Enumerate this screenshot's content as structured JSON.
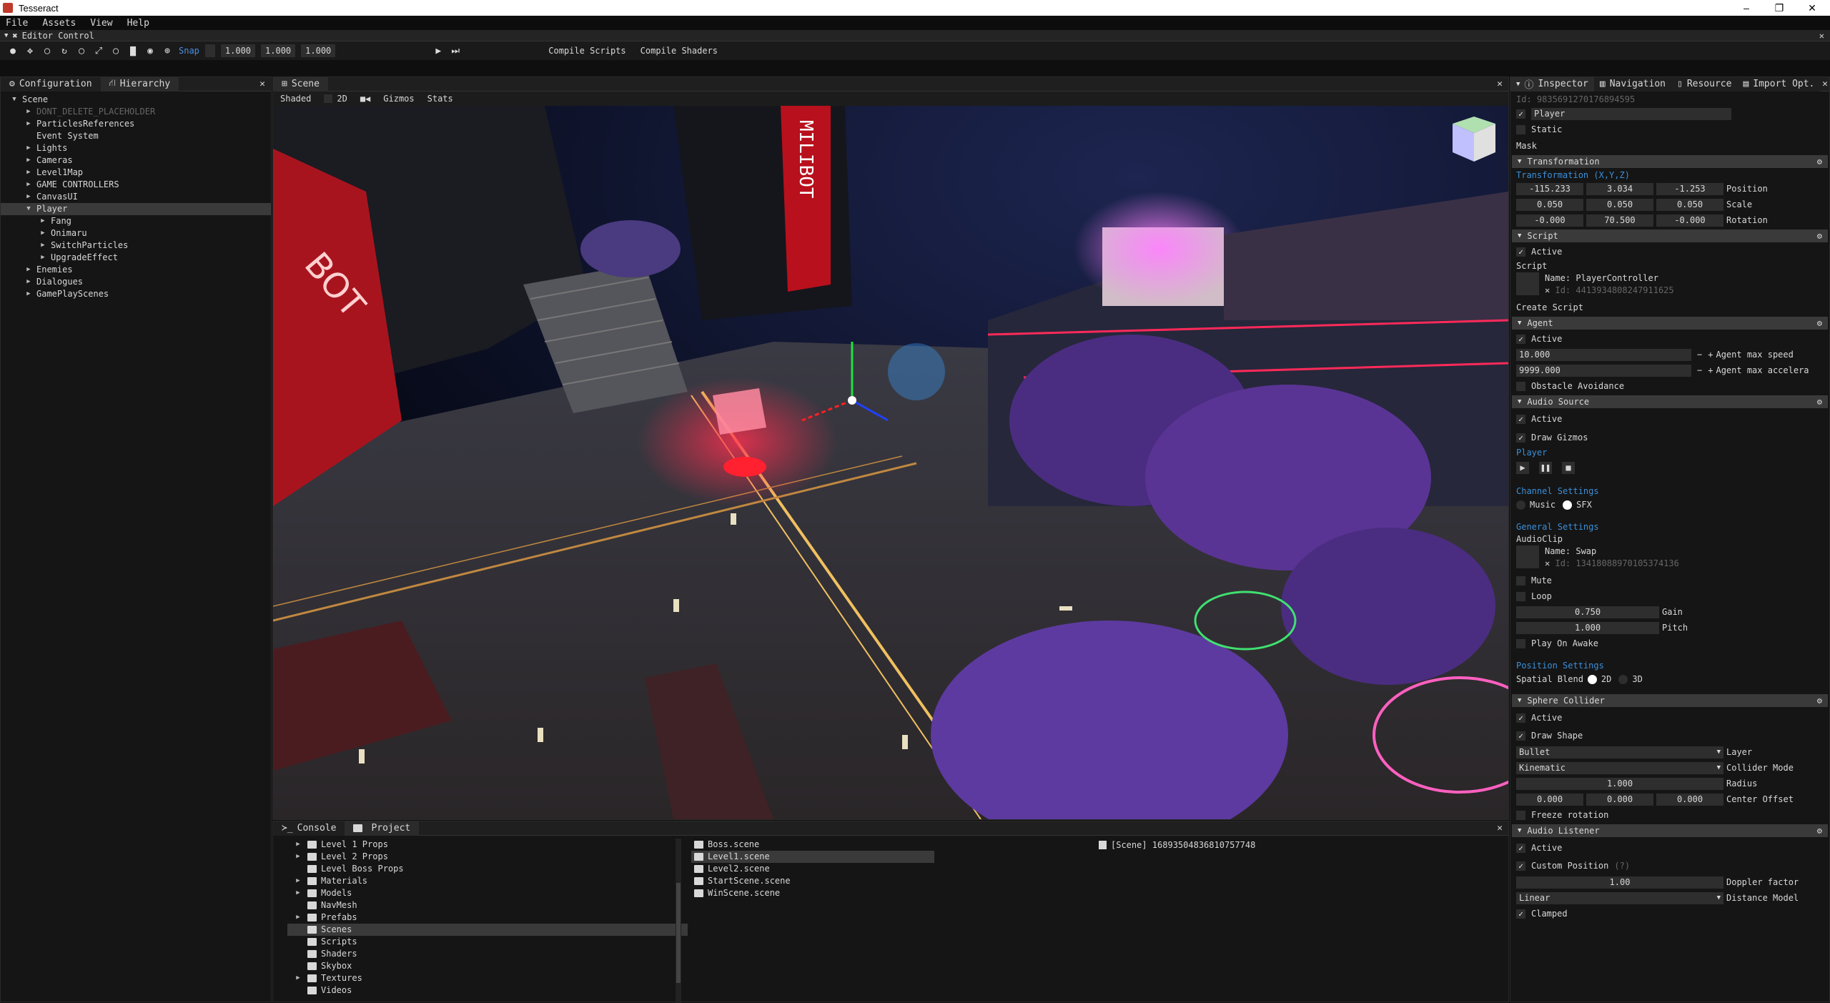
{
  "window": {
    "title": "Tesseract",
    "minimize": "–",
    "maximize": "❐",
    "close": "✕"
  },
  "menu": [
    "File",
    "Assets",
    "View",
    "Help"
  ],
  "editor_control": {
    "title": "Editor Control",
    "close": "✕"
  },
  "toolbar": {
    "snap_label": "Snap",
    "snap_values": [
      "1.000",
      "1.000",
      "1.000"
    ],
    "compile_scripts": "Compile Scripts",
    "compile_shaders": "Compile Shaders"
  },
  "left_panel": {
    "tabs": [
      "Configuration",
      "Hierarchy"
    ],
    "close": "✕",
    "tree": [
      {
        "label": "Scene",
        "depth": 0,
        "arrow": "▼",
        "dim": false,
        "selected": false
      },
      {
        "label": "DONT_DELETE_PLACEHOLDER",
        "depth": 1,
        "arrow": "▶",
        "dim": true,
        "selected": false
      },
      {
        "label": "ParticlesReferences",
        "depth": 1,
        "arrow": "▶",
        "dim": false,
        "selected": false
      },
      {
        "label": "Event System",
        "depth": 1,
        "arrow": "",
        "dim": false,
        "selected": false
      },
      {
        "label": "Lights",
        "depth": 1,
        "arrow": "▶",
        "dim": false,
        "selected": false
      },
      {
        "label": "Cameras",
        "depth": 1,
        "arrow": "▶",
        "dim": false,
        "selected": false
      },
      {
        "label": "Level1Map",
        "depth": 1,
        "arrow": "▶",
        "dim": false,
        "selected": false
      },
      {
        "label": "GAME CONTROLLERS",
        "depth": 1,
        "arrow": "▶",
        "dim": false,
        "selected": false
      },
      {
        "label": "CanvasUI",
        "depth": 1,
        "arrow": "▶",
        "dim": false,
        "selected": false
      },
      {
        "label": "Player",
        "depth": 1,
        "arrow": "▼",
        "dim": false,
        "selected": true
      },
      {
        "label": "Fang",
        "depth": 2,
        "arrow": "▶",
        "dim": false,
        "selected": false
      },
      {
        "label": "Onimaru",
        "depth": 2,
        "arrow": "▶",
        "dim": false,
        "selected": false
      },
      {
        "label": "SwitchParticles",
        "depth": 2,
        "arrow": "▶",
        "dim": false,
        "selected": false
      },
      {
        "label": "UpgradeEffect",
        "depth": 2,
        "arrow": "▶",
        "dim": false,
        "selected": false
      },
      {
        "label": "Enemies",
        "depth": 1,
        "arrow": "▶",
        "dim": false,
        "selected": false
      },
      {
        "label": "Dialogues",
        "depth": 1,
        "arrow": "▶",
        "dim": false,
        "selected": false
      },
      {
        "label": "GamePlayScenes",
        "depth": 1,
        "arrow": "▶",
        "dim": false,
        "selected": false
      }
    ]
  },
  "scene_panel": {
    "tab": "Scene",
    "close": "✕",
    "bar": [
      "Shaded",
      "2D",
      "Gizmos",
      "Stats"
    ],
    "signs": {
      "left": "BOT",
      "center": "MILIBOT"
    }
  },
  "bottom_panel": {
    "tabs": [
      "Console",
      "Project"
    ],
    "close": "✕",
    "folders": [
      {
        "label": "Level 1 Props",
        "arrow": "▶",
        "selected": false
      },
      {
        "label": "Level 2 Props",
        "arrow": "▶",
        "selected": false
      },
      {
        "label": "Level Boss Props",
        "arrow": "",
        "selected": false
      },
      {
        "label": "Materials",
        "arrow": "▶",
        "selected": false
      },
      {
        "label": "Models",
        "arrow": "▶",
        "selected": false
      },
      {
        "label": "NavMesh",
        "arrow": "",
        "selected": false
      },
      {
        "label": "Prefabs",
        "arrow": "▶",
        "selected": false
      },
      {
        "label": "Scenes",
        "arrow": "",
        "selected": true
      },
      {
        "label": "Scripts",
        "arrow": "",
        "selected": false
      },
      {
        "label": "Shaders",
        "arrow": "",
        "selected": false
      },
      {
        "label": "Skybox",
        "arrow": "",
        "selected": false
      },
      {
        "label": "Textures",
        "arrow": "▶",
        "selected": false
      },
      {
        "label": "Videos",
        "arrow": "",
        "selected": false
      }
    ],
    "files": [
      {
        "label": "Boss.scene",
        "selected": false
      },
      {
        "label": "Level1.scene",
        "selected": true
      },
      {
        "label": "Level2.scene",
        "selected": false
      },
      {
        "label": "StartScene.scene",
        "selected": false
      },
      {
        "label": "WinScene.scene",
        "selected": false
      }
    ],
    "detail": "[Scene] 16893504836810757748"
  },
  "inspector": {
    "tabs": [
      "Inspector",
      "Navigation",
      "Resource",
      "Import Opt."
    ],
    "close": "✕",
    "id": "Id: 9835691270176894595",
    "name": "Player",
    "static_label": "Static",
    "mask_label": "Mask",
    "transformation": {
      "header": "Transformation",
      "subheader": "Transformation (X,Y,Z)",
      "rows": [
        {
          "values": [
            "-115.233",
            "3.034",
            "-1.253"
          ],
          "label": "Position"
        },
        {
          "values": [
            "0.050",
            "0.050",
            "0.050"
          ],
          "label": "Scale"
        },
        {
          "values": [
            "-0.000",
            "70.500",
            "-0.000"
          ],
          "label": "Rotation"
        }
      ]
    },
    "script": {
      "header": "Script",
      "active": "Active",
      "label": "Script",
      "name": "Name: PlayerController",
      "id": "Id: 4413934808247911625",
      "create": "Create Script"
    },
    "agent": {
      "header": "Agent",
      "active": "Active",
      "speed": "10.000",
      "speed_label": "Agent max speed",
      "accel": "9999.000",
      "accel_label": "Agent max accelera",
      "avoidance": "Obstacle Avoidance"
    },
    "audio_source": {
      "header": "Audio Source",
      "active": "Active",
      "draw_gizmos": "Draw Gizmos",
      "player_label": "Player",
      "channel_label": "Channel Settings",
      "music": "Music",
      "sfx": "SFX",
      "general_label": "General Settings",
      "audioclip": "AudioClip",
      "clip_name": "Name: Swap",
      "clip_id": "Id: 13418088970105374136",
      "mute": "Mute",
      "loop": "Loop",
      "gain": "0.750",
      "gain_label": "Gain",
      "pitch": "1.000",
      "pitch_label": "Pitch",
      "play_on_awake": "Play On Awake",
      "position_label": "Position Settings",
      "spatial": "Spatial Blend",
      "opt2d": "2D",
      "opt3d": "3D"
    },
    "sphere_collider": {
      "header": "Sphere Collider",
      "active": "Active",
      "draw_shape": "Draw Shape",
      "layer": "Bullet",
      "layer_label": "Layer",
      "mode": "Kinematic",
      "mode_label": "Collider Mode",
      "radius": "1.000",
      "radius_label": "Radius",
      "offset": [
        "0.000",
        "0.000",
        "0.000"
      ],
      "offset_label": "Center Offset",
      "freeze": "Freeze rotation"
    },
    "audio_listener": {
      "header": "Audio Listener",
      "active": "Active",
      "custom_position": "Custom Position",
      "help": "(?)",
      "doppler": "1.00",
      "doppler_label": "Doppler factor",
      "distance_model": "Linear",
      "distance_label": "Distance Model",
      "clamped": "Clamped"
    }
  },
  "colors": {
    "accent_blue": "#3b8fd9",
    "neon_red": "#e0203a",
    "neon_purple": "#7a4fd6"
  }
}
